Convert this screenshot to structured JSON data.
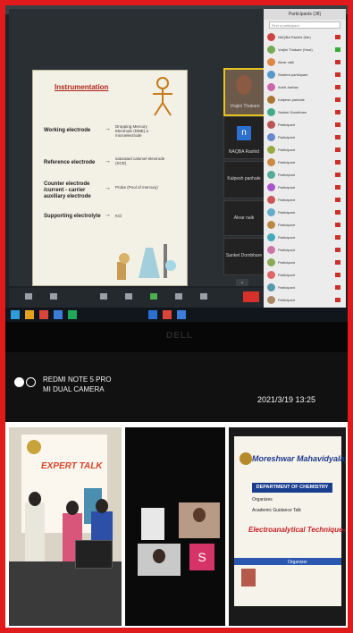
{
  "camera": {
    "model": "REDMI NOTE 5 PRO",
    "lens": "MI DUAL CAMERA",
    "timestamp": "2021/3/19  13:25"
  },
  "monitor": {
    "brand": "DELL",
    "slide": {
      "title": "Instrumentation",
      "rows": [
        {
          "label": "Working electrode",
          "desc": "Dropping Mercury Electrode (DME) a microelectrode"
        },
        {
          "label": "Reference electrode",
          "desc": "saturated calomel electrode (SCE)"
        },
        {
          "label": "Counter electrode /current - carrier auxiliary electrode",
          "desc": "Probe (Pool of mercury)"
        },
        {
          "label": "Supporting electrolyte",
          "desc": "KCl"
        }
      ]
    },
    "participants_title": "Participants (38)",
    "search_placeholder": "Find a participant",
    "tiles": [
      {
        "name": "Vrajini Thakare",
        "letter": ""
      },
      {
        "name": "NAQBA Rashid",
        "letter": "n"
      },
      {
        "name": "Kalpesh panhale",
        "letter": ""
      },
      {
        "name": "Akrar naik",
        "letter": ""
      },
      {
        "name": "Sanket Dombhare",
        "letter": ""
      }
    ]
  },
  "colors": {
    "frame": "#e01b1b",
    "slide_title": "#b0241b",
    "zoom_blue": "#2b6fd1",
    "end_red": "#d7312b"
  },
  "bottom_photos": {
    "banner_text": "EXPERT TALK",
    "poster": {
      "college": "Moreshwar Mahavidyalaya",
      "dept": "DEPARTMENT OF CHEMISTRY",
      "organizes": "Organizes",
      "talk": "Academic Guidance Talk",
      "topic": "Electroanalytical Technique-Polarog",
      "organizer_label": "Organizer"
    },
    "vc_letter": "S"
  }
}
